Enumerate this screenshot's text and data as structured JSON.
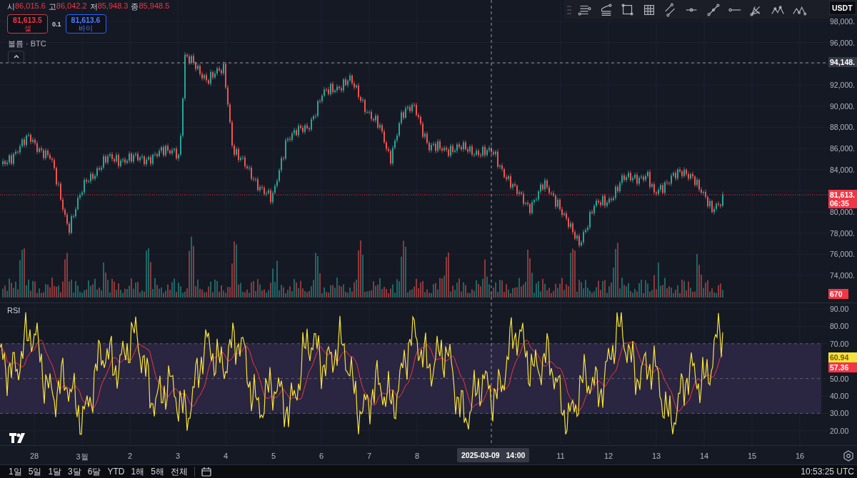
{
  "legend": {
    "items": [
      {
        "key": "시",
        "value": "86,015.6"
      },
      {
        "key": "고",
        "value": "86,042.2"
      },
      {
        "key": "저",
        "value": "85,948.3"
      },
      {
        "key": "종",
        "value": "85,948.5"
      }
    ]
  },
  "trade": {
    "sell": {
      "price": "81,613.5",
      "label": "셀"
    },
    "spread": "0.1",
    "buy": {
      "price": "81,613.6",
      "label": "바이"
    }
  },
  "volume_legend": "볼륨 · BTC",
  "currency": "USDT",
  "price_axis": {
    "ticks": [
      "98,000.",
      "96,000.",
      "92,000.",
      "90,000.",
      "88,000.",
      "86,000.",
      "84,000.",
      "80,000.",
      "78,000.",
      "76,000.",
      "74,000."
    ],
    "crosshair_label": "94,148.",
    "last_price": {
      "price": "81,613.",
      "countdown": "06:35"
    },
    "volume_label": "670"
  },
  "rsi": {
    "title": "RSI",
    "ticks": [
      "90.00",
      "80.00",
      "70.00",
      "50.00",
      "40.00",
      "30.00",
      "20.00"
    ],
    "value": "60.94",
    "average": "57.36"
  },
  "time_axis": {
    "ticks": [
      "28",
      "3월",
      "2",
      "3",
      "4",
      "5",
      "6",
      "7",
      "8",
      "11",
      "12",
      "13",
      "14",
      "15",
      "16"
    ],
    "crosshair_label": "2025-03-09   14:00"
  },
  "ranges": [
    {
      "label": "1일"
    },
    {
      "label": "5일"
    },
    {
      "label": "1달"
    },
    {
      "label": "3달"
    },
    {
      "label": "6달"
    },
    {
      "label": "YTD"
    },
    {
      "label": "1해"
    },
    {
      "label": "5해"
    },
    {
      "label": "전체"
    }
  ],
  "clock": "10:53:25 UTC"
}
